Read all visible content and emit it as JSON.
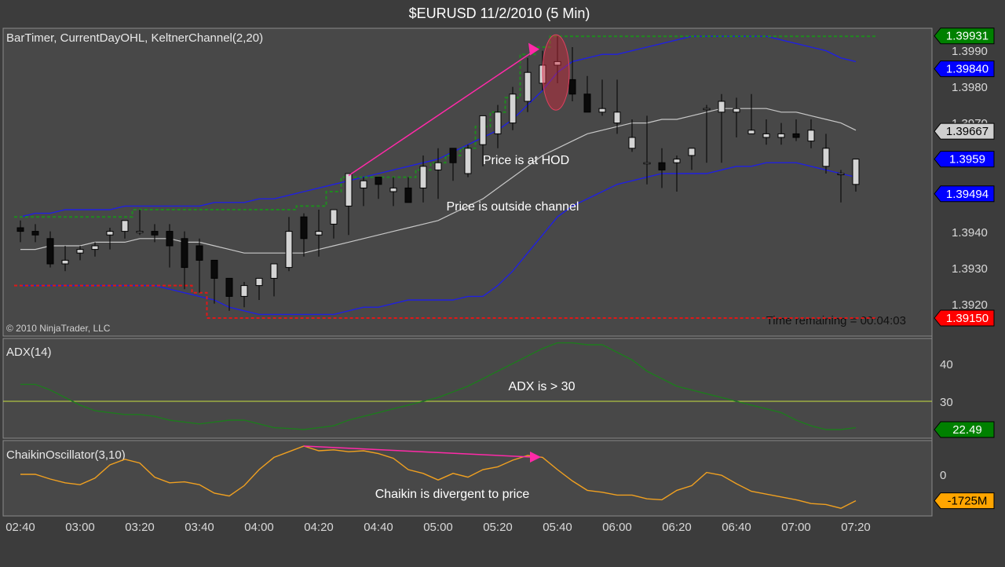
{
  "window": {
    "title": "$EURUSD  11/2/2010 (5 Min)"
  },
  "panels": {
    "price": {
      "label": "BarTimer, CurrentDayOHL, KeltnerChannel(2,20)",
      "copyright": "© 2010 NinjaTrader, LLC",
      "timer": "Time remaining = 00:04:03",
      "ticks": [
        "1.3990",
        "1.3980",
        "1.3970",
        "1.3940",
        "1.3930",
        "1.3920"
      ],
      "badges": [
        {
          "text": "1.39931",
          "color": "#008000"
        },
        {
          "text": "1.39840",
          "color": "#0000ff"
        },
        {
          "text": "1.39667",
          "color": "#cfcfcf"
        },
        {
          "text": "1.3959",
          "color": "#0000ff"
        },
        {
          "text": "1.39494",
          "color": "#0000ff"
        },
        {
          "text": "1.39150",
          "color": "#ff0000"
        }
      ],
      "annotations": [
        "Price is at HOD",
        "Price is outside channel"
      ]
    },
    "adx": {
      "label": "ADX(14)",
      "ticks": [
        "40",
        "30"
      ],
      "badge": {
        "text": "22.49",
        "color": "#008000"
      },
      "annotation": "ADX is > 30"
    },
    "chaikin": {
      "label": "ChaikinOscillator(3,10)",
      "ticks": [
        "0"
      ],
      "badge": {
        "text": "-1725M",
        "color": "#ffa500"
      },
      "annotation": "Chaikin is divergent to price"
    }
  },
  "chart_data": [
    {
      "type": "candlestick",
      "x": [
        "02:40",
        "02:45",
        "02:50",
        "02:55",
        "03:00",
        "03:05",
        "03:10",
        "03:15",
        "03:20",
        "03:25",
        "03:30",
        "03:35",
        "03:40",
        "03:45",
        "03:50",
        "03:55",
        "04:00",
        "04:05",
        "04:10",
        "04:15",
        "04:20",
        "04:25",
        "04:30",
        "04:35",
        "04:40",
        "04:45",
        "04:50",
        "04:55",
        "05:00",
        "05:05",
        "05:10",
        "05:15",
        "05:20",
        "05:25",
        "05:30",
        "05:35",
        "05:40",
        "05:45",
        "05:50",
        "05:55",
        "06:00",
        "06:05",
        "06:10",
        "06:15",
        "06:20",
        "06:25",
        "06:30",
        "06:35",
        "06:40",
        "06:45",
        "06:50",
        "06:55",
        "07:00",
        "07:05",
        "07:10",
        "07:15",
        "07:20"
      ],
      "open": [
        1.394,
        1.3939,
        1.3937,
        1.393,
        1.3933,
        1.3934,
        1.3938,
        1.3939,
        1.3939,
        1.3939,
        1.3939,
        1.3937,
        1.3935,
        1.3931,
        1.3926,
        1.3921,
        1.3924,
        1.3926,
        1.3929,
        1.3943,
        1.3938,
        1.3941,
        1.3946,
        1.3951,
        1.3954,
        1.395,
        1.3951,
        1.3951,
        1.3956,
        1.3962,
        1.3955,
        1.3963,
        1.3966,
        1.3969,
        1.3975,
        1.398,
        1.3985,
        1.3981,
        1.3977,
        1.3972,
        1.3969,
        1.3962,
        1.3958,
        1.3958,
        1.3958,
        1.396,
        1.3973,
        1.3972,
        1.3972,
        1.3966,
        1.3965,
        1.3965,
        1.3966,
        1.3964,
        1.3957,
        1.3955,
        1.3952
      ],
      "high": [
        1.3942,
        1.3941,
        1.3939,
        1.3935,
        1.3935,
        1.3936,
        1.394,
        1.3942,
        1.3945,
        1.3941,
        1.3941,
        1.3939,
        1.3937,
        1.3931,
        1.3926,
        1.3925,
        1.3926,
        1.393,
        1.3943,
        1.3944,
        1.3945,
        1.3945,
        1.3954,
        1.3954,
        1.3954,
        1.3954,
        1.3954,
        1.396,
        1.3962,
        1.3962,
        1.3963,
        1.397,
        1.3974,
        1.3979,
        1.3987,
        1.3989,
        1.3993,
        1.399,
        1.3982,
        1.3981,
        1.3981,
        1.397,
        1.3971,
        1.3962,
        1.396,
        1.3961,
        1.3974,
        1.3977,
        1.3976,
        1.3977,
        1.397,
        1.3969,
        1.397,
        1.397,
        1.3966,
        1.3956,
        1.3957
      ],
      "low": [
        1.3936,
        1.3936,
        1.3929,
        1.3928,
        1.3931,
        1.3932,
        1.3934,
        1.3937,
        1.3938,
        1.3936,
        1.3929,
        1.3923,
        1.3922,
        1.3919,
        1.3917,
        1.3918,
        1.392,
        1.3921,
        1.3928,
        1.3932,
        1.3932,
        1.3937,
        1.3938,
        1.3946,
        1.3948,
        1.3946,
        1.3948,
        1.3947,
        1.3948,
        1.3953,
        1.3954,
        1.3957,
        1.3962,
        1.3967,
        1.3972,
        1.3978,
        1.398,
        1.3975,
        1.3972,
        1.3971,
        1.3966,
        1.3961,
        1.3952,
        1.3951,
        1.395,
        1.3956,
        1.3958,
        1.3958,
        1.3965,
        1.3966,
        1.3963,
        1.3963,
        1.3964,
        1.3962,
        1.3955,
        1.3947,
        1.395
      ],
      "close": [
        1.3939,
        1.3938,
        1.393,
        1.3931,
        1.3934,
        1.3935,
        1.3939,
        1.3942,
        1.3939,
        1.3938,
        1.3935,
        1.3929,
        1.3931,
        1.3926,
        1.3921,
        1.3924,
        1.3926,
        1.393,
        1.3939,
        1.3937,
        1.3939,
        1.3945,
        1.3955,
        1.3953,
        1.3952,
        1.3951,
        1.3947,
        1.3957,
        1.3958,
        1.3958,
        1.3962,
        1.3971,
        1.3972,
        1.3977,
        1.3983,
        1.3985,
        1.3986,
        1.3977,
        1.3972,
        1.3973,
        1.3972,
        1.3965,
        1.3958,
        1.3956,
        1.3959,
        1.3962,
        1.3973,
        1.3975,
        1.3973,
        1.3967,
        1.3966,
        1.3966,
        1.3965,
        1.3967,
        1.3962,
        1.3955,
        1.3959
      ],
      "lines": {
        "keltner_upper": [
          1.3943,
          1.3944,
          1.3944,
          1.3945,
          1.3945,
          1.3945,
          1.3945,
          1.3946,
          1.3946,
          1.3946,
          1.3946,
          1.3946,
          1.3946,
          1.3947,
          1.3947,
          1.3947,
          1.3948,
          1.3948,
          1.3949,
          1.395,
          1.3951,
          1.3952,
          1.3953,
          1.3954,
          1.3955,
          1.3956,
          1.3957,
          1.3958,
          1.3959,
          1.3961,
          1.3963,
          1.3965,
          1.3967,
          1.397,
          1.3974,
          1.3978,
          1.3983,
          1.3986,
          1.3987,
          1.3988,
          1.3988,
          1.3989,
          1.399,
          1.3991,
          1.3992,
          1.3993,
          1.3993,
          1.3993,
          1.3993,
          1.3993,
          1.3993,
          1.3992,
          1.3991,
          1.399,
          1.3989,
          1.3987,
          1.3986
        ],
        "keltner_middle": [
          1.3934,
          1.3934,
          1.3935,
          1.3935,
          1.3935,
          1.3936,
          1.3936,
          1.3936,
          1.3937,
          1.3937,
          1.3937,
          1.3936,
          1.3936,
          1.3935,
          1.3934,
          1.3933,
          1.3933,
          1.3933,
          1.3933,
          1.3933,
          1.3934,
          1.3935,
          1.3936,
          1.3937,
          1.3938,
          1.3939,
          1.394,
          1.3941,
          1.3942,
          1.3944,
          1.3946,
          1.3948,
          1.3951,
          1.3954,
          1.3957,
          1.396,
          1.3962,
          1.3964,
          1.3966,
          1.3967,
          1.3968,
          1.3969,
          1.3969,
          1.397,
          1.397,
          1.3971,
          1.3972,
          1.3973,
          1.3973,
          1.3973,
          1.3973,
          1.3972,
          1.3972,
          1.3971,
          1.397,
          1.3969,
          1.3967
        ],
        "keltner_lower": [
          1.3924,
          1.3924,
          1.3924,
          1.3924,
          1.3924,
          1.3924,
          1.3924,
          1.3924,
          1.3924,
          1.3924,
          1.3923,
          1.3922,
          1.3921,
          1.392,
          1.3918,
          1.3917,
          1.3916,
          1.3916,
          1.3916,
          1.3916,
          1.3916,
          1.3916,
          1.3917,
          1.3918,
          1.3918,
          1.3919,
          1.392,
          1.392,
          1.392,
          1.392,
          1.3921,
          1.3921,
          1.3924,
          1.3928,
          1.3933,
          1.3938,
          1.3943,
          1.3946,
          1.3948,
          1.395,
          1.3952,
          1.3953,
          1.3954,
          1.3955,
          1.3955,
          1.3955,
          1.3955,
          1.3956,
          1.3957,
          1.3957,
          1.3958,
          1.3958,
          1.3958,
          1.3957,
          1.3956,
          1.3955,
          1.3954
        ],
        "day_high": [
          1.3943,
          1.3943,
          1.3943,
          1.3943,
          1.3943,
          1.3943,
          1.3943,
          1.3943,
          1.3945,
          1.3945,
          1.3945,
          1.3945,
          1.3945,
          1.3945,
          1.3945,
          1.3945,
          1.3945,
          1.3945,
          1.3945,
          1.3946,
          1.3946,
          1.395,
          1.3954,
          1.3954,
          1.3954,
          1.3954,
          1.3954,
          1.3956,
          1.3958,
          1.396,
          1.3962,
          1.3968,
          1.3972,
          1.3976,
          1.3988,
          1.399,
          1.3993,
          1.3993,
          1.3993,
          1.3993,
          1.3993,
          1.3993,
          1.3993,
          1.3993,
          1.3993,
          1.3993,
          1.3993,
          1.3993,
          1.3993,
          1.3993,
          1.3993,
          1.3993,
          1.3993,
          1.3993,
          1.3993,
          1.3993,
          1.3993
        ],
        "day_low": [
          1.3924,
          1.3924,
          1.3924,
          1.3924,
          1.3924,
          1.3924,
          1.3924,
          1.3924,
          1.3924,
          1.3924,
          1.3924,
          1.3924,
          1.3922,
          1.3915,
          1.3915,
          1.3915,
          1.3915,
          1.3915,
          1.3915,
          1.3915,
          1.3915,
          1.3915,
          1.3915,
          1.3915,
          1.3915,
          1.3915,
          1.3915,
          1.3915,
          1.3915,
          1.3915,
          1.3915,
          1.3915,
          1.3915,
          1.3915,
          1.3915,
          1.3915,
          1.3915,
          1.3915,
          1.3915,
          1.3915,
          1.3915,
          1.3915,
          1.3915,
          1.3915,
          1.3915,
          1.3915,
          1.3915,
          1.3915,
          1.3915,
          1.3915,
          1.3915,
          1.3915,
          1.3915,
          1.3915,
          1.3915,
          1.3915,
          1.3915
        ]
      },
      "ylim": [
        1.3912,
        1.3994
      ]
    },
    {
      "type": "line",
      "series": [
        {
          "name": "ADX(14)",
          "values": [
            34.5,
            34.5,
            33,
            31,
            29,
            27.5,
            27,
            26.5,
            26.5,
            26,
            25,
            24.5,
            24,
            24.5,
            25,
            25,
            24,
            23,
            22.8,
            22.5,
            23,
            23.5,
            25,
            26,
            27,
            28,
            29,
            30,
            31,
            32.5,
            34,
            36,
            38,
            40,
            42,
            44,
            45.5,
            45.5,
            45,
            45,
            43,
            41,
            38,
            36,
            34,
            33,
            32,
            31,
            30,
            29,
            28,
            27,
            25,
            23.5,
            22.5,
            22.5,
            23
          ]
        }
      ],
      "ylim": [
        18,
        48
      ],
      "reference": 30
    },
    {
      "type": "line",
      "series": [
        {
          "name": "ChaikinOscillator(3,10)",
          "values": [
            0,
            0,
            -5,
            -9,
            -11,
            -4,
            10,
            16,
            12,
            -3,
            -9,
            -8,
            -11,
            -20,
            -23,
            -12,
            5,
            18,
            24,
            30,
            25,
            26,
            24,
            25,
            22,
            17,
            5,
            1,
            -6,
            1,
            -3,
            5,
            8,
            15,
            20,
            18,
            5,
            -7,
            -17,
            -19,
            -22,
            -22,
            -26,
            -27,
            -17,
            -12,
            2,
            -1,
            -10,
            -18,
            -21,
            -24,
            -27,
            -31,
            -32,
            -36,
            -28
          ],
          "marker_label": "-1725M"
        }
      ],
      "ylim": [
        -40,
        35
      ],
      "reference": 0
    }
  ]
}
